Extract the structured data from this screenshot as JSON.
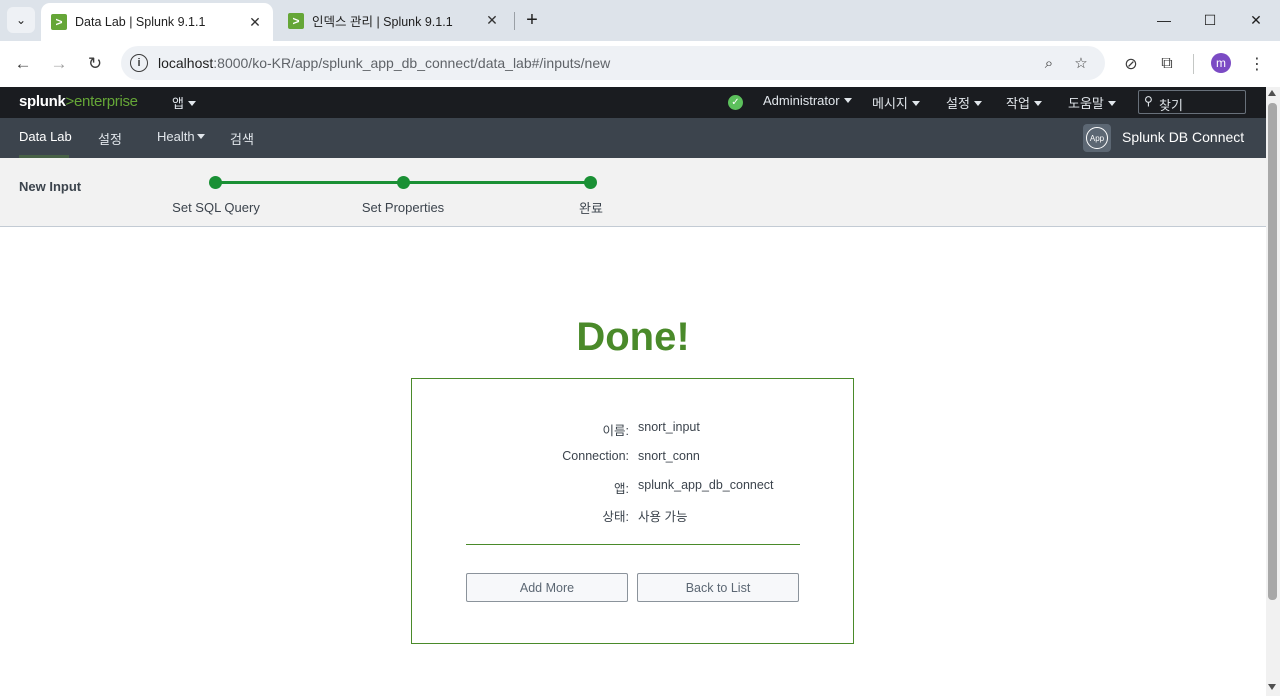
{
  "browser": {
    "tabs": [
      {
        "title": "Data Lab | Splunk 9.1.1",
        "favicon": ">",
        "active": true
      },
      {
        "title": "인덱스 관리 | Splunk 9.1.1",
        "favicon": ">",
        "active": false
      }
    ],
    "url_host": "localhost",
    "url_path": ":8000/ko-KR/app/splunk_app_db_connect/data_lab#/inputs/new",
    "profile_initial": "m",
    "icons": {
      "tab_menu": "chevron-down-icon",
      "tab_close": "close-icon",
      "new_tab": "plus-icon",
      "back": "arrow-left-icon",
      "forward": "arrow-right-icon",
      "reload": "reload-icon",
      "site_info": "info-icon",
      "zoom": "zoom-icon",
      "bookmark": "star-icon",
      "extension": "puzzle-icon",
      "menu": "kebab-icon"
    }
  },
  "splunk_header": {
    "logo_prefix": "splunk",
    "logo_gt": ">",
    "logo_suffix": "enterprise",
    "apps_menu": "앱",
    "user_menu": "Administrator",
    "messages_menu": "메시지",
    "settings_menu": "설정",
    "activity_menu": "작업",
    "help_menu": "도움말",
    "search_placeholder": "찾기"
  },
  "app_bar": {
    "items": [
      {
        "label": "Data Lab",
        "active": true
      },
      {
        "label": "설정",
        "active": false
      },
      {
        "label": "Health",
        "active": false
      },
      {
        "label": "검색",
        "active": false
      }
    ],
    "app_icon_text": "App",
    "app_name": "Splunk DB Connect"
  },
  "wizard": {
    "title": "New Input",
    "steps": [
      "Set SQL Query",
      "Set Properties",
      "완료"
    ],
    "accent": "#1a9035"
  },
  "result": {
    "heading": "Done!",
    "fields": [
      {
        "label": "이름:",
        "value": "snort_input"
      },
      {
        "label": "Connection:",
        "value": "snort_conn"
      },
      {
        "label": "앱:",
        "value": "splunk_app_db_connect"
      },
      {
        "label": "상태:",
        "value": "사용 가능"
      }
    ],
    "add_more_label": "Add More",
    "back_to_list_label": "Back to List",
    "accent": "#4a8a2a"
  }
}
